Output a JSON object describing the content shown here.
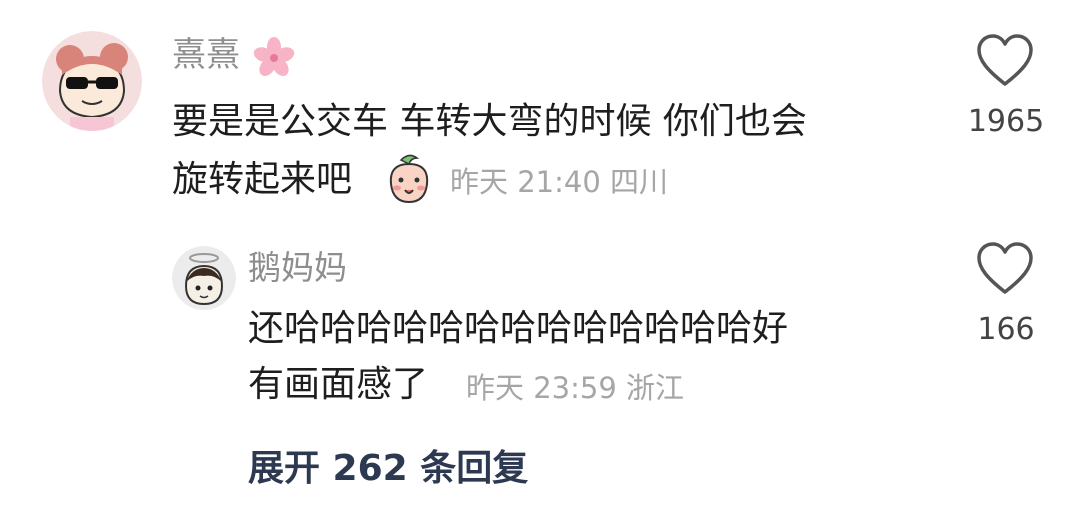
{
  "comments": [
    {
      "username": "熹熹",
      "text_line1": "要是是公交车 车转大弯的时候 你们也会",
      "text_line2": "旋转起来吧",
      "meta": "昨天 21:40 四川",
      "likes": "1965",
      "avatar_icon": "cartoon-girl-sunglasses-avatar",
      "badge_icon": "cherry-blossom-icon",
      "inline_emoji": "peach-emoji"
    },
    {
      "username": "鹅妈妈",
      "text_line1": "还哈哈哈哈哈哈哈哈哈哈哈哈哈好",
      "text_line2": "有画面感了",
      "meta": "昨天 23:59 浙江",
      "likes": "166",
      "avatar_icon": "angel-character-avatar"
    }
  ],
  "expand_replies_label": "展开 262 条回复",
  "colors": {
    "username": "#8e8e8e",
    "comment_text": "#1e1e1e",
    "meta_text": "#a6a6a6",
    "expand_link": "#2c3950",
    "heart_outline": "#555555"
  }
}
